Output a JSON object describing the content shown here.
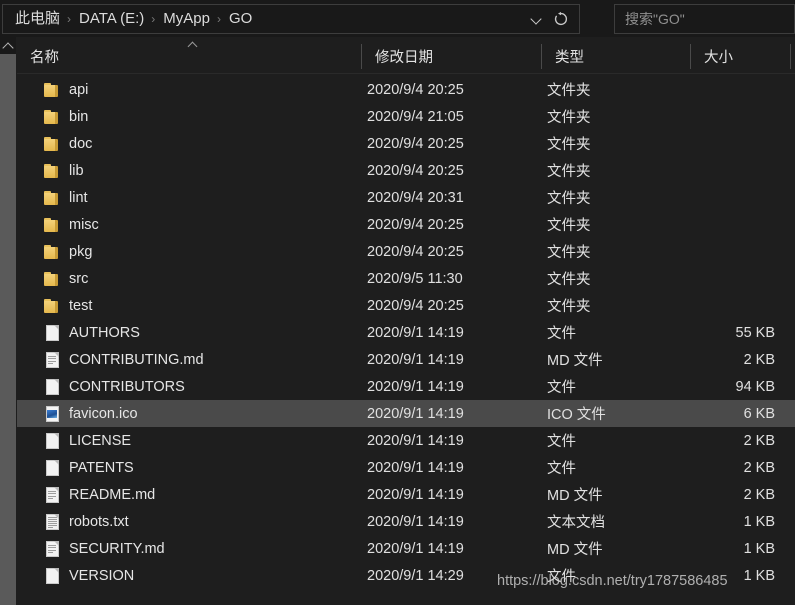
{
  "window": {
    "background": "#1e1e1e",
    "accent_selected": "#4a4a4a"
  },
  "address_bar": {
    "breadcrumb": [
      "此电脑",
      "DATA (E:)",
      "MyApp",
      "GO"
    ],
    "separator": "›",
    "dropdown_icon": "chevron-down-icon",
    "refresh_icon": "refresh-icon"
  },
  "search": {
    "placeholder": "搜索\"GO\"",
    "value": ""
  },
  "columns": {
    "name": "名称",
    "date": "修改日期",
    "type": "类型",
    "size": "大小",
    "sort_by": "名称",
    "sort_direction": "ascending"
  },
  "files": [
    {
      "icon": "folder-icon",
      "name": "api",
      "date": "2020/9/4 20:25",
      "type": "文件夹",
      "size": "",
      "selected": false
    },
    {
      "icon": "folder-icon",
      "name": "bin",
      "date": "2020/9/4 21:05",
      "type": "文件夹",
      "size": "",
      "selected": false
    },
    {
      "icon": "folder-icon",
      "name": "doc",
      "date": "2020/9/4 20:25",
      "type": "文件夹",
      "size": "",
      "selected": false
    },
    {
      "icon": "folder-icon",
      "name": "lib",
      "date": "2020/9/4 20:25",
      "type": "文件夹",
      "size": "",
      "selected": false
    },
    {
      "icon": "folder-icon",
      "name": "lint",
      "date": "2020/9/4 20:31",
      "type": "文件夹",
      "size": "",
      "selected": false
    },
    {
      "icon": "folder-icon",
      "name": "misc",
      "date": "2020/9/4 20:25",
      "type": "文件夹",
      "size": "",
      "selected": false
    },
    {
      "icon": "folder-icon",
      "name": "pkg",
      "date": "2020/9/4 20:25",
      "type": "文件夹",
      "size": "",
      "selected": false
    },
    {
      "icon": "folder-icon",
      "name": "src",
      "date": "2020/9/5 11:30",
      "type": "文件夹",
      "size": "",
      "selected": false
    },
    {
      "icon": "folder-icon",
      "name": "test",
      "date": "2020/9/4 20:25",
      "type": "文件夹",
      "size": "",
      "selected": false
    },
    {
      "icon": "file-icon",
      "name": "AUTHORS",
      "date": "2020/9/1 14:19",
      "type": "文件",
      "size": "55 KB",
      "selected": false
    },
    {
      "icon": "md-file-icon",
      "name": "CONTRIBUTING.md",
      "date": "2020/9/1 14:19",
      "type": "MD 文件",
      "size": "2 KB",
      "selected": false
    },
    {
      "icon": "file-icon",
      "name": "CONTRIBUTORS",
      "date": "2020/9/1 14:19",
      "type": "文件",
      "size": "94 KB",
      "selected": false
    },
    {
      "icon": "ico-file-icon",
      "name": "favicon.ico",
      "date": "2020/9/1 14:19",
      "type": "ICO 文件",
      "size": "6 KB",
      "selected": true
    },
    {
      "icon": "file-icon",
      "name": "LICENSE",
      "date": "2020/9/1 14:19",
      "type": "文件",
      "size": "2 KB",
      "selected": false
    },
    {
      "icon": "file-icon",
      "name": "PATENTS",
      "date": "2020/9/1 14:19",
      "type": "文件",
      "size": "2 KB",
      "selected": false
    },
    {
      "icon": "md-file-icon",
      "name": "README.md",
      "date": "2020/9/1 14:19",
      "type": "MD 文件",
      "size": "2 KB",
      "selected": false
    },
    {
      "icon": "txt-file-icon",
      "name": "robots.txt",
      "date": "2020/9/1 14:19",
      "type": "文本文档",
      "size": "1 KB",
      "selected": false
    },
    {
      "icon": "md-file-icon",
      "name": "SECURITY.md",
      "date": "2020/9/1 14:19",
      "type": "MD 文件",
      "size": "1 KB",
      "selected": false
    },
    {
      "icon": "file-icon",
      "name": "VERSION",
      "date": "2020/9/1 14:29",
      "type": "文件",
      "size": "1 KB",
      "selected": false
    }
  ],
  "watermark": "https://blog.csdn.net/try1787586485"
}
